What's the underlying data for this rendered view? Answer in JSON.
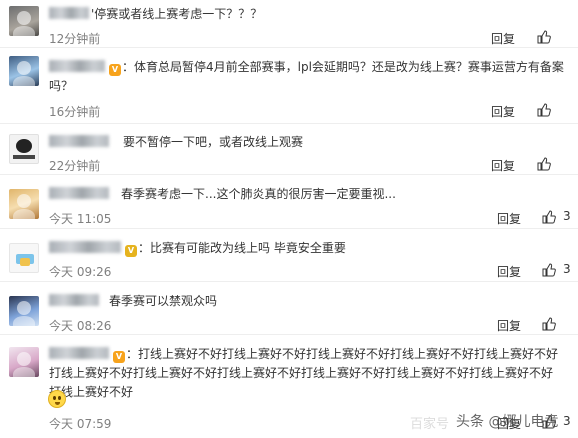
{
  "colors": {
    "text": "#333333",
    "meta": "#808080",
    "divider": "#eeeeee",
    "vip_badge": "#f7a31c",
    "watermark": "#d8d8d8"
  },
  "comments": [
    {
      "name_suffix": "",
      "text": "'停赛或者线上赛考虑一下？？？",
      "time": "12分钟前",
      "reply": "回复",
      "like_count": "",
      "avatar_icon": "user-avatar-icon"
    },
    {
      "name_suffix": "",
      "text": "：体育总局暂停4月前全部赛事，lpl会延期吗？还是改为线上赛？赛事运营方有备案吗？",
      "time": "16分钟前",
      "reply": "回复",
      "like_count": "",
      "avatar_icon": "user-avatar-icon"
    },
    {
      "name_suffix": "",
      "text": "要不暂停一下吧，或者改线上观赛",
      "time": "22分钟前",
      "reply": "回复",
      "like_count": "",
      "avatar_icon": "user-avatar-icon"
    },
    {
      "name_suffix": "",
      "text": "春季赛考虑一下...这个肺炎真的很厉害一定要重视...",
      "time": "今天 11:05",
      "reply": "回复",
      "like_count": "3",
      "avatar_icon": "user-avatar-icon"
    },
    {
      "name_suffix": "",
      "text": "：比赛有可能改为线上吗 毕竟安全重要",
      "time": "今天 09:26",
      "reply": "回复",
      "like_count": "3",
      "avatar_icon": "user-avatar-icon"
    },
    {
      "name_suffix": "",
      "text": "春季赛可以禁观众吗",
      "time": "今天 08:26",
      "reply": "回复",
      "like_count": "",
      "avatar_icon": "user-avatar-icon"
    },
    {
      "name_suffix": "",
      "text": "：打线上赛好不好打线上赛好不好打线上赛好不好打线上赛好不好打线上赛好不好打线上赛好不好打线上赛好不好打线上赛好不好打线上赛好不好打线上赛好不好打线上赛好不好打线上赛好不好",
      "time": "今天 07:59",
      "reply": "回复",
      "like_count": "3",
      "avatar_icon": "user-avatar-icon"
    }
  ],
  "watermark": {
    "left": "百家号",
    "right": "头条 @娜儿电竞"
  }
}
